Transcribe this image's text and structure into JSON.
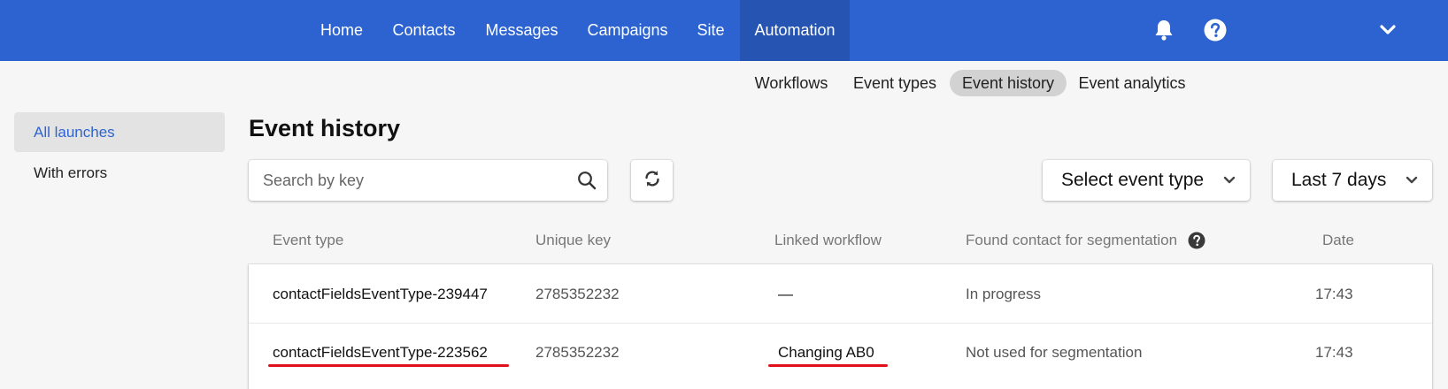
{
  "topnav": {
    "items": [
      {
        "label": "Home",
        "active": false
      },
      {
        "label": "Contacts",
        "active": false
      },
      {
        "label": "Messages",
        "active": false
      },
      {
        "label": "Campaigns",
        "active": false
      },
      {
        "label": "Site",
        "active": false
      },
      {
        "label": "Automation",
        "active": true
      }
    ],
    "icons": [
      "bell-icon",
      "help-icon",
      "chevron-down-icon"
    ]
  },
  "subnav": {
    "items": [
      {
        "label": "Workflows",
        "active": false
      },
      {
        "label": "Event types",
        "active": false
      },
      {
        "label": "Event history",
        "active": true
      },
      {
        "label": "Event analytics",
        "active": false
      }
    ]
  },
  "sidebar": {
    "items": [
      {
        "label": "All launches",
        "active": true
      },
      {
        "label": "With errors",
        "active": false
      }
    ]
  },
  "main": {
    "title": "Event history",
    "search": {
      "placeholder": "Search by key",
      "value": ""
    },
    "event_type_select": {
      "label": "Select event type"
    },
    "period_select": {
      "label": "Last 7 days"
    }
  },
  "table": {
    "columns": [
      "Event type",
      "Unique key",
      "Linked workflow",
      "Found contact for segmentation",
      "Date"
    ],
    "rows": [
      {
        "event_type": "contactFieldsEventType-239447",
        "unique_key": "2785352232",
        "linked_workflow": "—",
        "segmentation": "In progress",
        "date": "17:43"
      },
      {
        "event_type": "contactFieldsEventType-223562",
        "unique_key": "2785352232",
        "linked_workflow": "Changing AB0",
        "segmentation": "Not used for segmentation",
        "date": "17:43"
      }
    ]
  },
  "colors": {
    "topbar": "#2c63d0",
    "topbar_active": "#2654b2",
    "accent_link": "#2f64cf",
    "annotation_underline": "#e0101a"
  }
}
